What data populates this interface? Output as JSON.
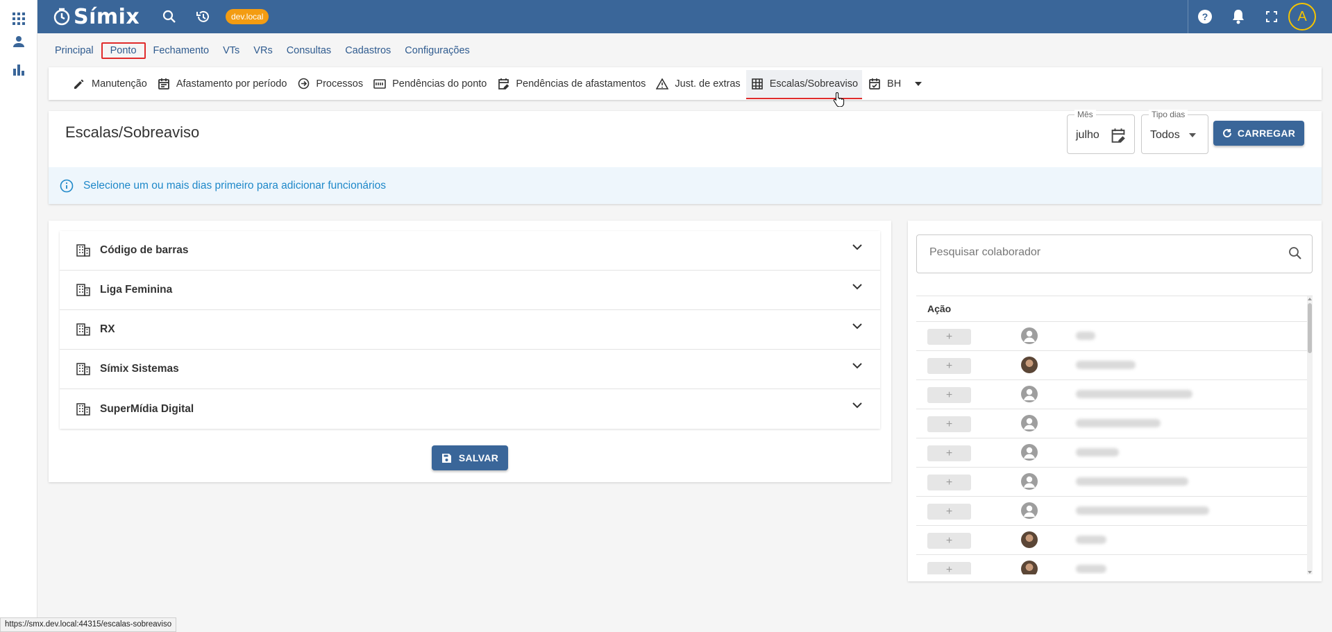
{
  "app": {
    "name": "Símix",
    "env_badge": "dev.local"
  },
  "colors": {
    "primary": "#3a6699",
    "accent_red": "#e02b2b",
    "badge": "#f39c12",
    "info": "#1e88c9",
    "avatar_ring": "#f5c400"
  },
  "topbar": {
    "icons": [
      "search-icon",
      "history-icon",
      "help-icon",
      "notifications-icon",
      "fullscreen-icon"
    ],
    "avatar_initial": "A"
  },
  "rail": {
    "icons": [
      "apps-grid-icon",
      "person-icon",
      "bar-chart-icon"
    ]
  },
  "main_nav": {
    "tabs": [
      {
        "label": "Principal"
      },
      {
        "label": "Ponto",
        "active": true
      },
      {
        "label": "Fechamento"
      },
      {
        "label": "VTs"
      },
      {
        "label": "VRs"
      },
      {
        "label": "Consultas"
      },
      {
        "label": "Cadastros"
      },
      {
        "label": "Configurações"
      }
    ]
  },
  "sub_nav": {
    "items": [
      {
        "label": "Manutenção",
        "icon": "pencil-icon"
      },
      {
        "label": "Afastamento por período",
        "icon": "calendar-icon"
      },
      {
        "label": "Processos",
        "icon": "arrow-circle-icon"
      },
      {
        "label": "Pendências do ponto",
        "icon": "badge-icon"
      },
      {
        "label": "Pendências de afastamentos",
        "icon": "calendar-edit-icon"
      },
      {
        "label": "Just. de extras",
        "icon": "warning-icon"
      },
      {
        "label": "Escalas/Sobreaviso",
        "icon": "table-grid-icon",
        "active": true
      },
      {
        "label": "BH",
        "icon": "calendar-check-icon"
      }
    ]
  },
  "header": {
    "title": "Escalas/Sobreaviso",
    "month_field": {
      "label": "Mês",
      "value": "julho"
    },
    "day_type_field": {
      "label": "Tipo dias",
      "value": "Todos"
    },
    "load_button": "CARREGAR",
    "info_message": "Selecione um ou mais dias primeiro para adicionar funcionários"
  },
  "companies": {
    "items": [
      {
        "label": "Código de barras"
      },
      {
        "label": "Liga Feminina"
      },
      {
        "label": "RX"
      },
      {
        "label": "Símix Sistemas"
      },
      {
        "label": "SuperMídia Digital"
      }
    ],
    "save_button": "SALVAR"
  },
  "employees": {
    "search_placeholder": "Pesquisar colaborador",
    "column_header": "Ação",
    "rows": [
      {
        "avatar": "default"
      },
      {
        "avatar": "photo"
      },
      {
        "avatar": "default"
      },
      {
        "avatar": "default"
      },
      {
        "avatar": "default"
      },
      {
        "avatar": "default"
      },
      {
        "avatar": "default"
      },
      {
        "avatar": "photo"
      },
      {
        "avatar": "photo"
      }
    ]
  },
  "status_url": "https://smx.dev.local:44315/escalas-sobreaviso"
}
